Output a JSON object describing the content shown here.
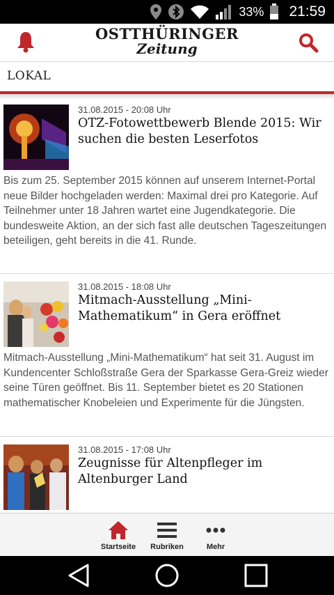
{
  "status_bar": {
    "battery_percent": "33%",
    "time": "21:59",
    "icons": [
      "location-icon",
      "bluetooth-icon",
      "wifi-icon",
      "signal-icon",
      "battery-icon"
    ]
  },
  "app_bar": {
    "logo_line1": "OSTTHÜRINGER",
    "logo_line2": "Zeitung",
    "left_icon": "bell-icon",
    "right_icon": "search-icon",
    "accent_color": "#c0262c"
  },
  "section": {
    "label": "LOKAL"
  },
  "articles": [
    {
      "date": "31.08.2015 - 20:08 Uhr",
      "title": "OTZ-Fotowettbewerb Blende 2015: Wir suchen die besten Leserfotos",
      "teaser": "Bis zum 25. September 2015 können auf unserem Internet-Portal neue Bilder hochgeladen werden: Maximal drei pro Kategorie. Auf Teilnehmer unter 18 Jahren wartet eine Jugendkategorie. Die bundesweite Aktion, an der sich fast alle deutschen Tageszeitungen beteiligen, geht bereits in die 41. Runde."
    },
    {
      "date": "31.08.2015 - 18:08 Uhr",
      "title": "Mitmach-Ausstellung „Mini-Mathematikum“ in Gera eröffnet",
      "teaser": "Mitmach-Ausstellung „Mini-Mathematikum“ hat seit 31. August im Kundencenter Schloßstraße Gera der Sparkasse Gera-Greiz wieder seine Türen geöffnet. Bis 11. September bietet es 20 Stationen mathematischer Knobeleien und Experimente für die Jüngsten."
    },
    {
      "date": "31.08.2015 - 17:08 Uhr",
      "title": "Zeugnisse für Altenpfleger im Altenburger Land",
      "teaser": ""
    }
  ],
  "bottom_nav": [
    {
      "label": "Startseite",
      "icon": "home-icon"
    },
    {
      "label": "Rubriken",
      "icon": "menu-icon"
    },
    {
      "label": "Mehr",
      "icon": "more-icon"
    }
  ],
  "system_nav": [
    "back-icon",
    "home-circle-icon",
    "recents-icon"
  ]
}
